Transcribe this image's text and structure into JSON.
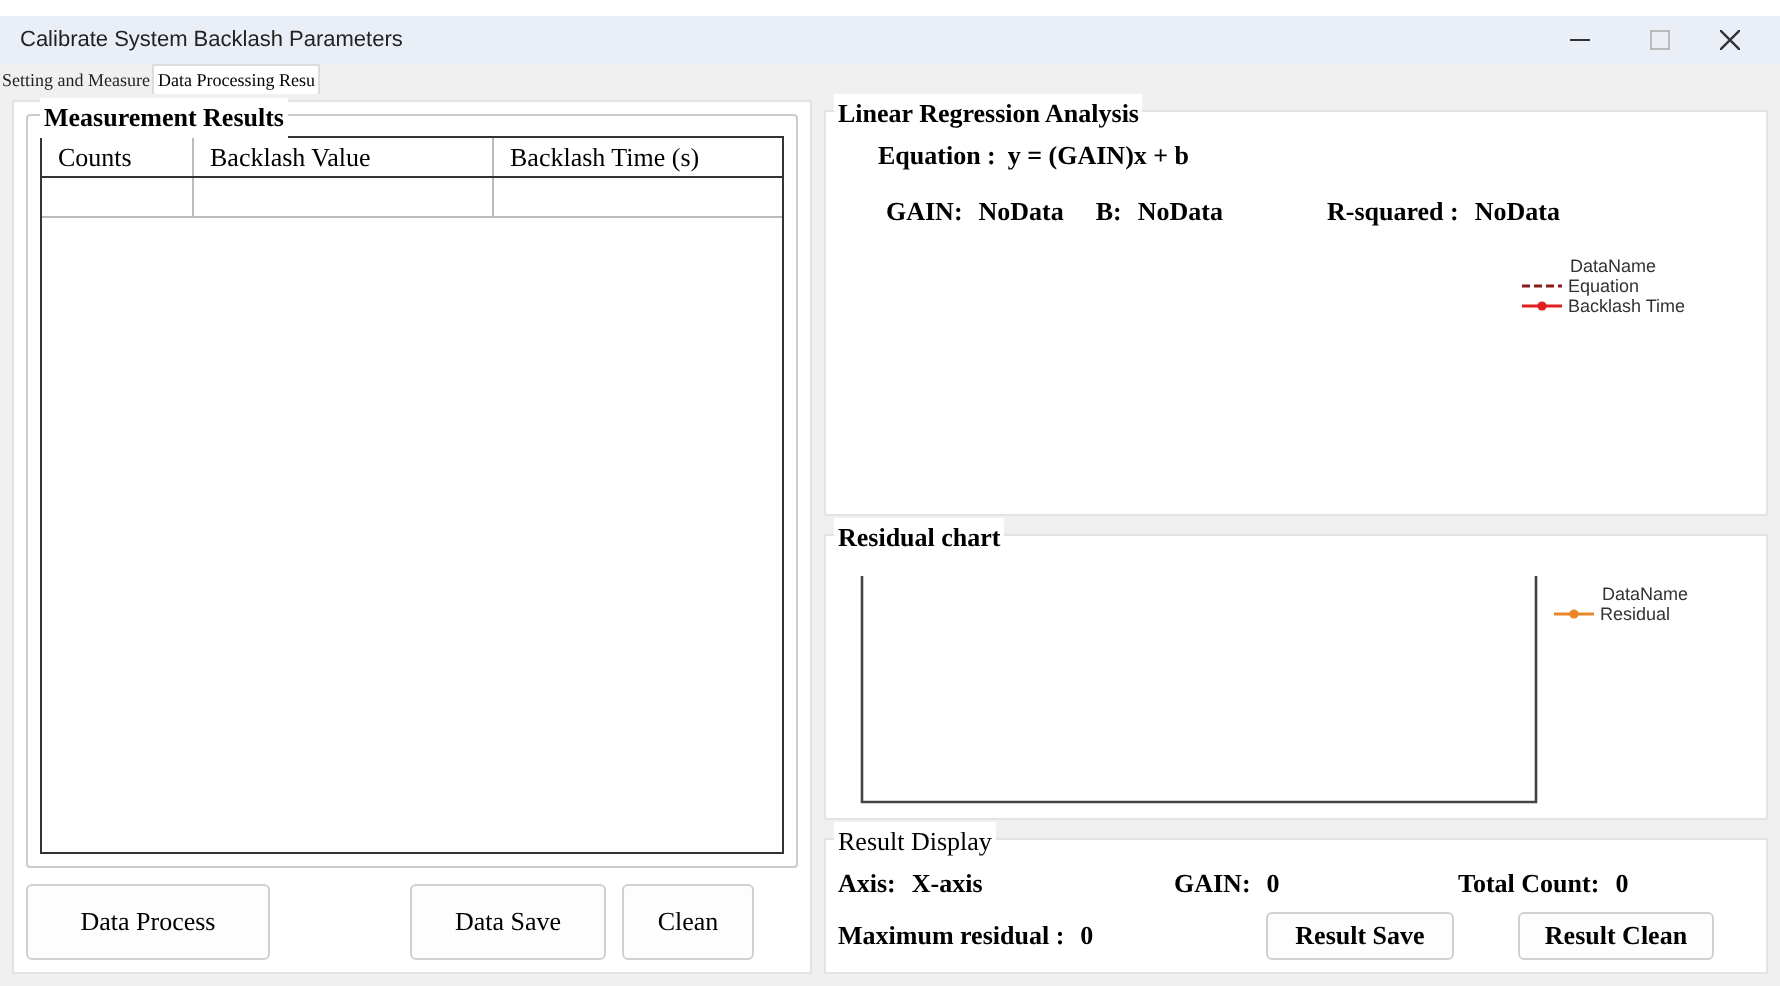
{
  "window": {
    "title": "Calibrate System Backlash Parameters"
  },
  "tabs": [
    {
      "label": "Setting and Measure",
      "selected": false
    },
    {
      "label": "Data Processing Resu",
      "selected": true
    }
  ],
  "measurement_results": {
    "title": "Measurement Results",
    "columns": [
      "Counts",
      "Backlash Value",
      "Backlash Time (s)"
    ],
    "buttons": [
      "Data Process",
      "Data Save",
      "Clean"
    ]
  },
  "linear_regression": {
    "title": "Linear Regression Analysis",
    "equation_label": "Equation :",
    "equation": "y = (GAIN)x + b",
    "stats": [
      {
        "label": "GAIN:",
        "value": "NoData"
      },
      {
        "label": "B:",
        "value": "NoData"
      },
      {
        "label": "R-squared :",
        "value": "NoData"
      }
    ],
    "legend": {
      "title": "DataName",
      "items": [
        {
          "label": "Equation",
          "kind": "dashed",
          "color": "#8b1a1a"
        },
        {
          "label": "Backlash Time",
          "kind": "marker",
          "color": "#e02020"
        }
      ]
    }
  },
  "residual_chart": {
    "title": "Residual chart",
    "legend": {
      "title": "DataName",
      "items": [
        {
          "label": "Residual",
          "kind": "marker",
          "color": "#e8872a"
        }
      ]
    }
  },
  "result_display": {
    "title": "Result Display",
    "fields": [
      {
        "label": "Axis:",
        "value": "X-axis"
      },
      {
        "label": "GAIN:",
        "value": "0"
      },
      {
        "label": "Total Count:",
        "value": "0"
      },
      {
        "label": "Maximum residual :",
        "value": "0"
      }
    ],
    "buttons": [
      "Result Save",
      "Result Clean"
    ]
  }
}
